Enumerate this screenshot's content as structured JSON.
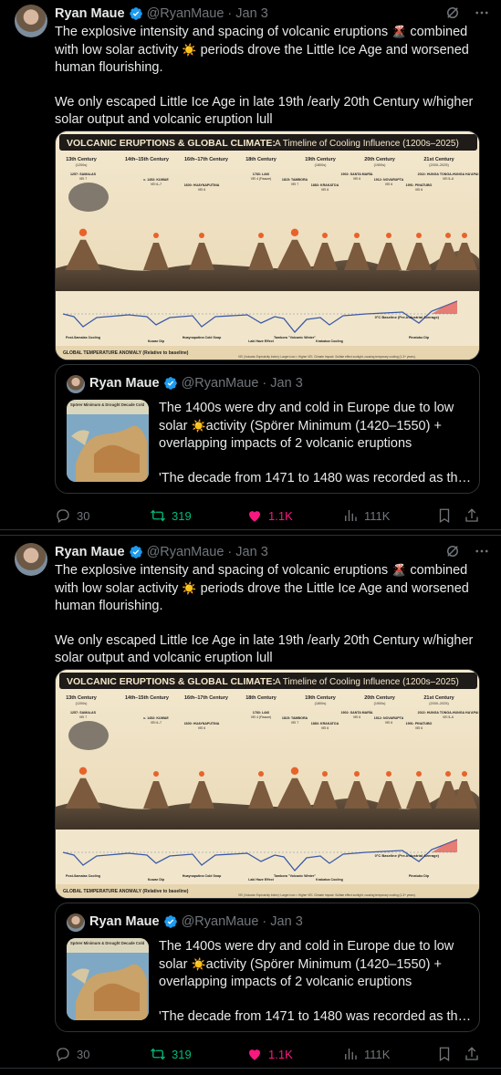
{
  "tweets": [
    {
      "author": {
        "name": "Ryan Maue",
        "handle": "@RyanMaue",
        "time": "Jan 3"
      },
      "text_p1_a": "The explosive intensity and spacing of volcanic eruptions ",
      "text_p1_emoji1": "🌋",
      "text_p1_b": " combined with low solar activity ",
      "text_p1_emoji2": "☀️",
      "text_p1_c": " periods drove the Little Ice Age and worsened human flourishing.",
      "text_p2": "We only escaped Little Ice Age in late 19th /early 20th Century w/higher solar output and volcanic eruption lull",
      "infographic": {
        "title_bold": "VOLCANIC ERUPTIONS & GLOBAL CLIMATE:",
        "title_rest": "A Timeline of Cooling Influence (1200s–2025)",
        "centuries": [
          {
            "label": "13th Century",
            "sub": "(1200s)"
          },
          {
            "label": "14th–15th Century",
            "sub": ""
          },
          {
            "label": "16th–17th Century",
            "sub": ""
          },
          {
            "label": "18th Century",
            "sub": ""
          },
          {
            "label": "19th Century",
            "sub": "(1800s)"
          },
          {
            "label": "20th Century",
            "sub": "(1900s)"
          },
          {
            "label": "21st Century",
            "sub": "(2000–2025)"
          }
        ],
        "eruptions": [
          {
            "name": "1257: SAMALAS",
            "sub": "(Indonesia)",
            "vei": "VEI 7"
          },
          {
            "name": "c. 1452: KUWAE",
            "sub": "(Vanuatu)",
            "vei": "VEI 6–7"
          },
          {
            "name": "1600: HUAYNAPUTINA",
            "sub": "(Peru)",
            "vei": "VEI 6"
          },
          {
            "name": "1783: LAKI",
            "sub": "(Iceland)",
            "vei": "VEI 4 (Fissure)"
          },
          {
            "name": "1815: TAMBORA",
            "sub": "(Indonesia)",
            "vei": "VEI 7"
          },
          {
            "name": "1883: KRAKATOA",
            "sub": "(Indonesia)",
            "vei": "VEI 6"
          },
          {
            "name": "1902: SANTA MARÍA",
            "sub": "(Guatemala)",
            "vei": "VEI 6"
          },
          {
            "name": "1912: NOVARUPTA",
            "sub": "(Alaska)",
            "vei": "VEI 6"
          },
          {
            "name": "1991: PINATUBO",
            "sub": "(Philippines)",
            "vei": "VEI 6"
          },
          {
            "name": "2022: HUNGA TONGA-HUNGA HA'APAI",
            "sub": "(Tonga)",
            "vei": "VEI 5–6"
          },
          {
            "name": "2024–2025: Ongoing Minor Activity",
            "sub": "",
            "vei": ""
          }
        ],
        "dips": [
          "Post-Samalas Cooling",
          "Kuwae Dip",
          "Huaynaputina Cold Snap",
          "Laki Haze Effect",
          "Tambora \"Volcanic Winter\"",
          "Krakatoa Cooling",
          "Pinatubo Dip"
        ],
        "baseline": "0°C Baseline (Pre-Industrial Average)",
        "anomaly_label": "GLOBAL TEMPERATURE ANOMALY",
        "anomaly_sub": "(Relative to baseline)",
        "footer": "VEI (Volcanic Explosivity Index): Larger icon = Higher VEI.  Climate Impact: Sulfate effect sunlight, causing temporary cooling (1-3+ years)."
      },
      "quote": {
        "author": {
          "name": "Ryan Maue",
          "handle": "@RyanMaue",
          "time": "Jan 3"
        },
        "text_a": "The 1400s were dry and cold in Europe due to low solar ",
        "text_emoji": "☀️",
        "text_b": "activity (Spörer Minimum (1420–1550) + overlapping impacts of 2  volcanic eruptions",
        "text_2": "'The decade from 1471 to 1480 was recorded as the ...",
        "thumb_caption": "Spörer Minimum & Drought Decade Cold"
      },
      "stats": {
        "replies": "30",
        "reposts": "319",
        "likes": "1.1K",
        "views": "111K"
      }
    }
  ],
  "colors": {
    "accent_blue": "#1d9bf0",
    "repost_green": "#00ba7c",
    "like_pink": "#f91880",
    "muted": "#71767b"
  }
}
